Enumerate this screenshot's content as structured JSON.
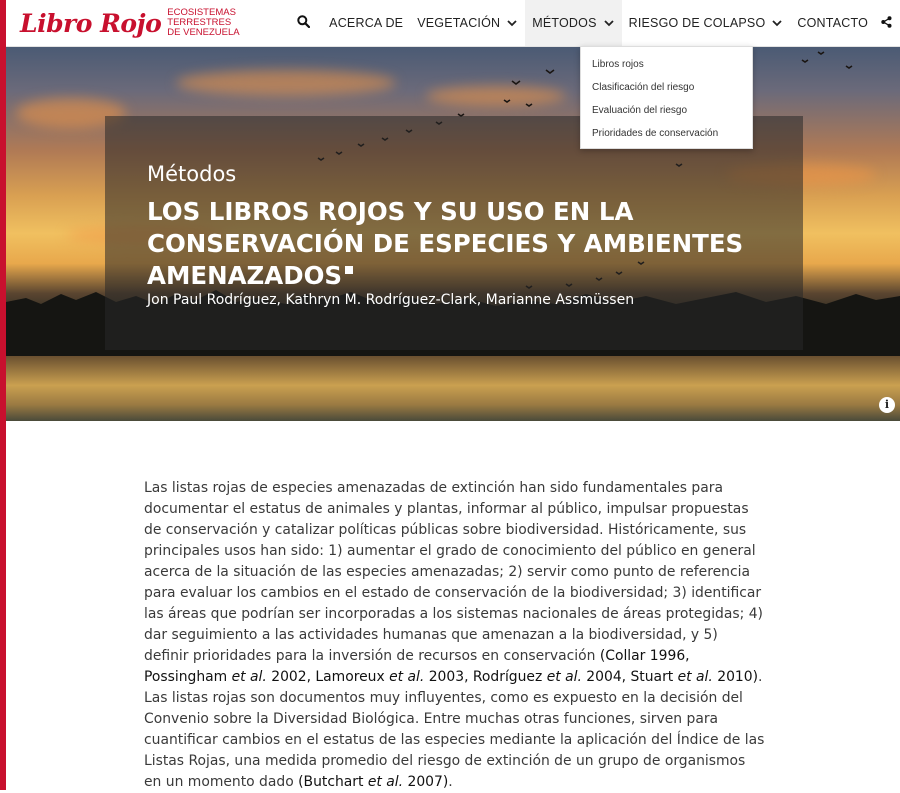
{
  "brand": {
    "script": "Libro Rojo",
    "sub_lines": [
      "ECOSISTEMAS",
      "TERRESTRES",
      "DE VENEZUELA"
    ],
    "color": "#c8102e"
  },
  "nav": {
    "search_icon": "search-icon",
    "items": [
      {
        "label": "ACERCA DE",
        "has_dropdown": false
      },
      {
        "label": "VEGETACIÓN",
        "has_dropdown": true
      },
      {
        "label": "MÉTODOS",
        "has_dropdown": true,
        "active": true
      },
      {
        "label": "RIESGO DE COLAPSO",
        "has_dropdown": true
      },
      {
        "label": "CONTACTO",
        "has_dropdown": false
      }
    ],
    "share_icon": "share-icon"
  },
  "dropdown": {
    "items": [
      "Libros rojos",
      "Clasificación del riesgo",
      "Evaluación del riesgo",
      "Prioridades de conservación"
    ]
  },
  "hero": {
    "section": "Métodos",
    "title": "LOS LIBROS ROJOS Y SU USO EN LA CONSERVACIÓN DE ESPECIES Y AMBIENTES AMENAZADOS",
    "authors": "Jon Paul Rodríguez, Kathryn M. Rodríguez-Clark, Marianne Assmüssen",
    "info_icon": "info-icon"
  },
  "article": {
    "p1_a": "Las listas rojas de especies amenazadas de extinción han sido fundamentales para documentar el estatus de animales y plantas, informar al público, impulsar propuestas de conservación y catalizar políticas públicas sobre biodiversidad. Históricamente, sus principales usos han sido: 1) aumentar el grado de conocimiento del público en general acerca de la situación de las especies amenazadas; 2) servir como punto de referencia para evaluar los cambios en el estado de conservación de la biodiversidad; 3) identificar las áreas que podrían ser incorporadas a los sistemas nacionales de áreas protegidas; 4) dar seguimiento a las actividades humanas que amenazan a la biodiversidad, y 5) definir prioridades para la inversión de recursos en conservación ",
    "cite1_a": "(Collar 1996, Possingham ",
    "etal": "et al.",
    "cite1_b": " 2002, Lamoreux ",
    "cite1_c": " 2003, Rodríguez ",
    "cite1_d": " 2004, Stuart ",
    "cite1_e": " 2010)",
    "p1_b": ". Las listas rojas son documentos muy influyentes, como es expuesto en la decisión del Convenio sobre la Diversidad Biológica. Entre muchas otras funciones, sirven para cuantificar cambios en el estatus de las especies mediante la aplicación del Índice de las Listas Rojas, una medida promedio del riesgo de extinción de un grupo de organismos en un momento dado ",
    "cite2_a": "(Butchart ",
    "cite2_b": " 2007)",
    "end": "."
  }
}
